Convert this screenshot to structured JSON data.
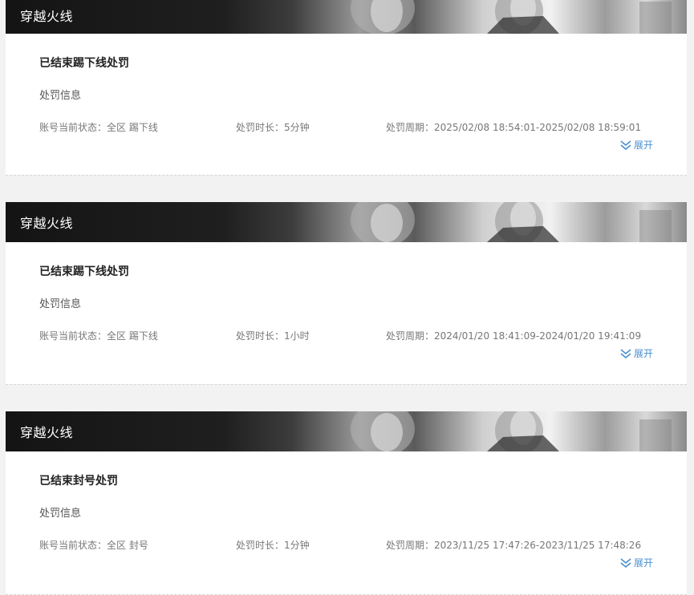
{
  "records": [
    {
      "game_name": "穿越火线",
      "status_title": "已结束踢下线处罚",
      "section_label": "处罚信息",
      "account_status": "账号当前状态：全区 踢下线",
      "duration": "处罚时长：5分钟",
      "period": "处罚周期：2025/02/08 18:54:01-2025/02/08 18:59:01",
      "expand_label": "展开"
    },
    {
      "game_name": "穿越火线",
      "status_title": "已结束踢下线处罚",
      "section_label": "处罚信息",
      "account_status": "账号当前状态：全区 踢下线",
      "duration": "处罚时长：1小时",
      "period": "处罚周期：2024/01/20 18:41:09-2024/01/20 19:41:09",
      "expand_label": "展开"
    },
    {
      "game_name": "穿越火线",
      "status_title": "已结束封号处罚",
      "section_label": "处罚信息",
      "account_status": "账号当前状态：全区 封号",
      "duration": "处罚时长：1分钟",
      "period": "处罚周期：2023/11/25 17:47:26-2023/11/25 17:48:26",
      "expand_label": "展开"
    }
  ],
  "colors": {
    "banner_dark": "#1a1a1a",
    "expand_link": "#4a8fd0",
    "title_text": "#222222",
    "meta_text": "#777777"
  },
  "icons": {
    "expand": "double-chevron-down-icon"
  }
}
